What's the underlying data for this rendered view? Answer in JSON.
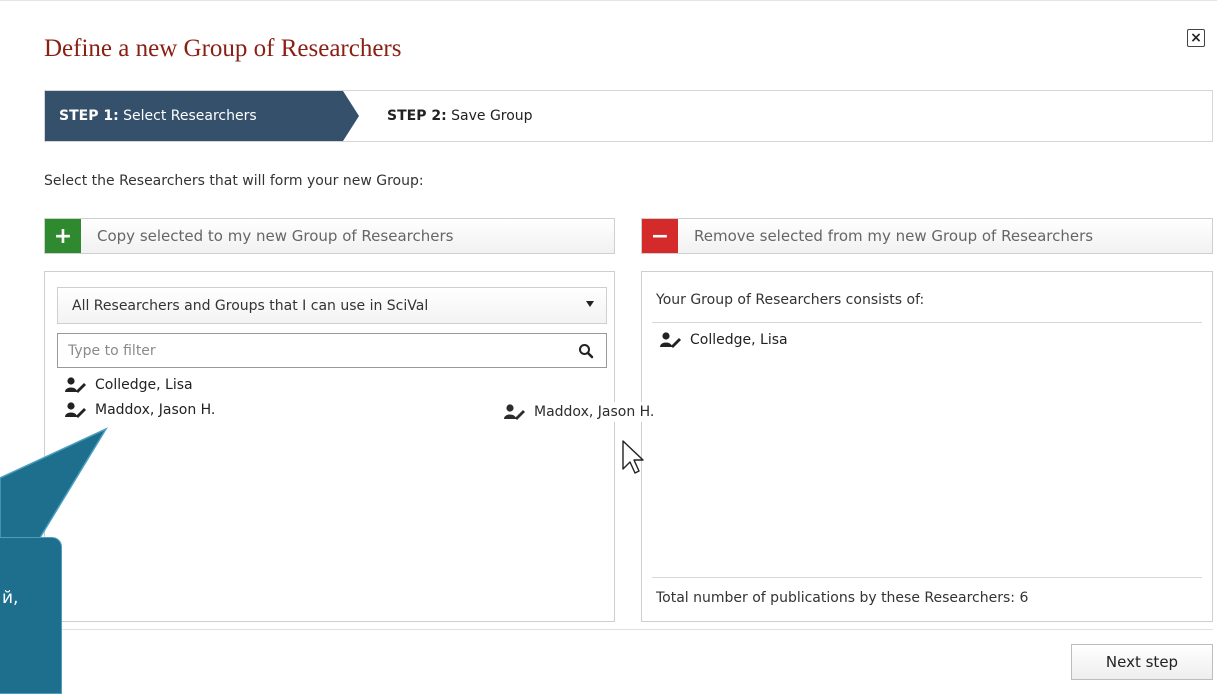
{
  "dialog": {
    "title": "Define a new Group of Researchers",
    "close_label": "×"
  },
  "steps": {
    "step1_prefix": "STEP 1:",
    "step1_label": "Select Researchers",
    "step2_prefix": "STEP 2:",
    "step2_label": "Save Group"
  },
  "instruction": "Select the Researchers that will form your new Group:",
  "actions": {
    "copy_symbol": "+",
    "copy_label": "Copy selected to my new Group of Researchers",
    "remove_symbol": "−",
    "remove_label": "Remove selected from my new Group of Researchers"
  },
  "source_panel": {
    "dropdown_selected": "All Researchers and Groups that I can use in SciVal",
    "filter_placeholder": "Type to filter",
    "filter_value": "",
    "researchers": [
      "Colledge, Lisa",
      "Maddox, Jason H."
    ]
  },
  "group_panel": {
    "header": "Your Group of Researchers consists of:",
    "members": [
      "Colledge, Lisa"
    ],
    "footer": "Total number of publications by these Researchers: 6"
  },
  "drag": {
    "item_label": "Maddox, Jason H."
  },
  "footer": {
    "next_label": "Next step"
  },
  "callout": {
    "visible_text": "й,"
  },
  "colors": {
    "title": "#8a1f14",
    "step_active": "#34506b",
    "copy_green": "#2f8a2f",
    "remove_red": "#d42a2a",
    "callout_bg": "#1e6f8e"
  },
  "icons": {
    "researcher": "researcher-icon",
    "search": "search-icon",
    "close": "close-icon",
    "dropdown": "chevron-down-icon",
    "cursor": "mouse-pointer-icon"
  }
}
